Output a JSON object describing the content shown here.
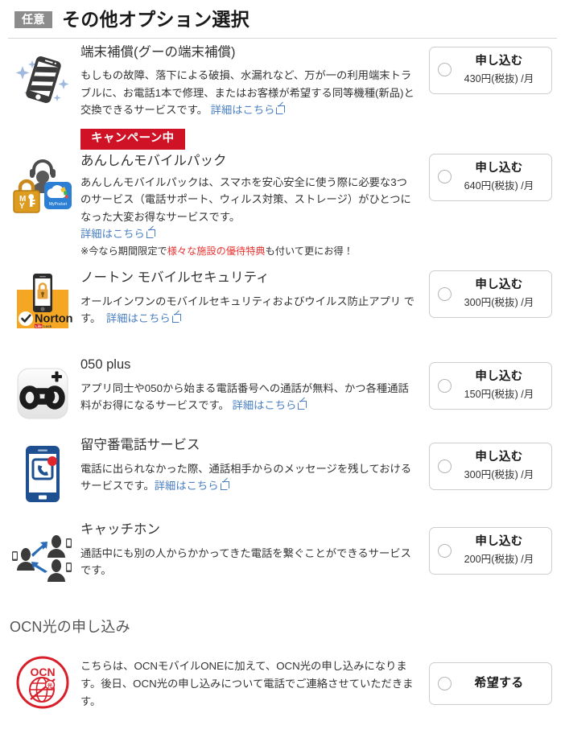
{
  "header": {
    "badge": "任意",
    "title": "その他オプション選択"
  },
  "options": [
    {
      "id": "device-warranty",
      "icon": "sparkle-smartphone-icon",
      "title": "端末補償(グーの端末補償)",
      "desc_before_link": "もしもの故障、落下による破損、水漏れなど、万が一の利用端末トラブルに、お電話1本で修理、またはお客様が希望する同等機種(新品)と交換できるサービスです。 ",
      "link_label": "詳細はこちら",
      "has_campaign": false,
      "action": {
        "label": "申し込む",
        "price": "430円(税抜) /月",
        "selected": false
      }
    },
    {
      "id": "anshin-mobile-pack",
      "icon": "lock-headset-cloud-icon",
      "campaign_label": "キャンペーン中",
      "title": "あんしんモバイルパック",
      "desc_before_link": "あんしんモバイルパックは、スマホを安心安全に使う際に必要な3つのサービス（電話サポート、ウィルス対策、ストレージ）がひとつになった大変お得なサービスです。",
      "link_label": "詳細はこちら",
      "has_campaign": true,
      "note_prefix": "※今なら期間限定で",
      "note_highlight": "様々な施設の優待特典",
      "note_suffix": "も付いて更にお得！",
      "action": {
        "label": "申し込む",
        "price": "640円(税抜) /月",
        "selected": false
      }
    },
    {
      "id": "norton-mobile-security",
      "icon": "norton-shield-phone-icon",
      "icon_brand": "Norton",
      "icon_brand_sub": "LifeLock",
      "title": "ノートン モバイルセキュリティ",
      "desc_before_link": "オールインワンのモバイルセキュリティおよびウイルス防止アプリ です。　",
      "link_label": "詳細はこちら",
      "has_campaign": false,
      "action": {
        "label": "申し込む",
        "price": "300円(税抜) /月",
        "selected": false
      }
    },
    {
      "id": "050-plus",
      "icon": "050-plus-app-icon",
      "icon_text": "050",
      "title": "050 plus",
      "desc_before_link": "アプリ同士や050から始まる電話番号への通話が無料、かつ各種通話料がお得になるサービスです。 ",
      "link_label": "詳細はこちら",
      "has_campaign": false,
      "action": {
        "label": "申し込む",
        "price": "150円(税抜) /月",
        "selected": false
      }
    },
    {
      "id": "voicemail",
      "icon": "voicemail-phone-icon",
      "title": "留守番電話サービス",
      "desc_before_link": "電話に出られなかった際、通話相手からのメッセージを残しておけるサービスです。",
      "link_label": "詳細はこちら",
      "has_campaign": false,
      "action": {
        "label": "申し込む",
        "price": "300円(税抜) /月",
        "selected": false
      }
    },
    {
      "id": "call-waiting",
      "icon": "call-waiting-people-icon",
      "title": "キャッチホン",
      "desc_before_link": "通話中にも別の人からかかってきた電話を繋ぐことができるサービスです。",
      "link_label": "",
      "has_campaign": false,
      "action": {
        "label": "申し込む",
        "price": "200円(税抜) /月",
        "selected": false
      }
    }
  ],
  "ocn_section": {
    "heading": "OCN光の申し込み",
    "icon": "ocn-hikari-logo-icon",
    "icon_text": "OCN",
    "desc": "こちらは、OCNモバイルONEに加えて、OCN光の申し込みになります。後日、OCN光の申し込みについて電話でご連絡させていただきます。",
    "action": {
      "label": "希望する",
      "selected": false
    }
  },
  "colors": {
    "badge_gray": "#8c8c8c",
    "campaign_red": "#cf1225",
    "link_blue": "#4a7fc1",
    "note_red": "#e8322e",
    "norton_orange": "#f5a623",
    "ocn_red": "#d81f2a",
    "phone_blue": "#1d4f91"
  }
}
